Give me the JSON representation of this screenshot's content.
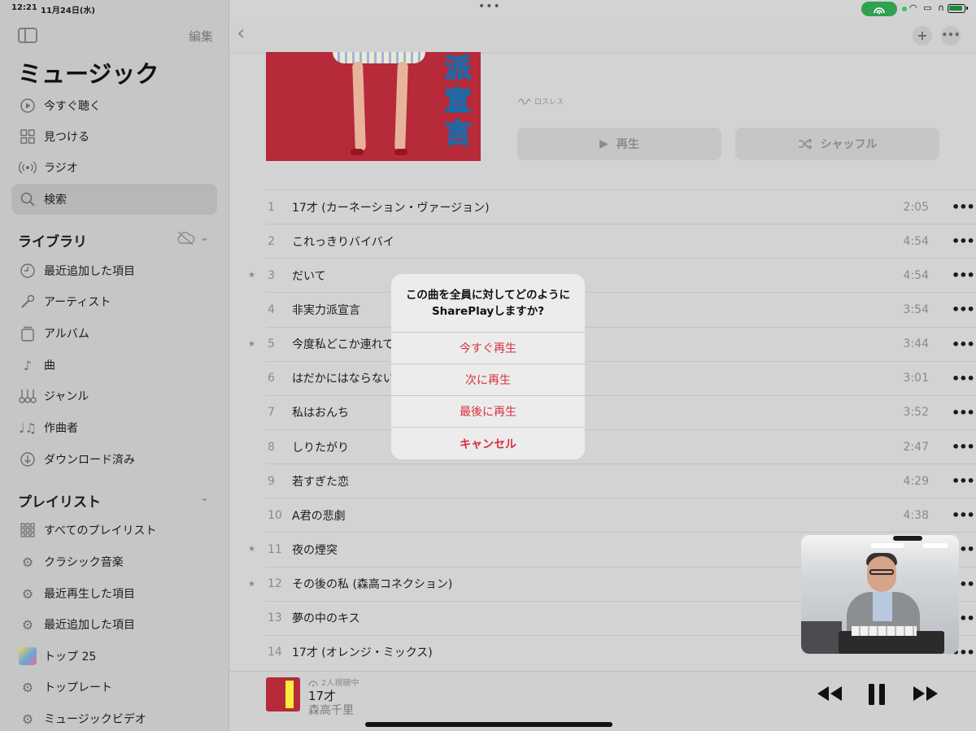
{
  "status_bar": {
    "time": "12:21",
    "date": "11月24日(水)"
  },
  "sidebar": {
    "edit_label": "編集",
    "title": "ミュージック",
    "nav": [
      {
        "label": "今すぐ聴く",
        "icon": "play-circle-icon"
      },
      {
        "label": "見つける",
        "icon": "grid-icon"
      },
      {
        "label": "ラジオ",
        "icon": "radio-icon"
      },
      {
        "label": "検索",
        "icon": "search-icon",
        "selected": true
      }
    ],
    "library_heading": "ライブラリ",
    "library": [
      {
        "label": "最近追加した項目",
        "icon": "clock-icon"
      },
      {
        "label": "アーティスト",
        "icon": "microphone-icon"
      },
      {
        "label": "アルバム",
        "icon": "album-icon"
      },
      {
        "label": "曲",
        "icon": "note-icon"
      },
      {
        "label": "ジャンル",
        "icon": "guitars-icon"
      },
      {
        "label": "作曲者",
        "icon": "notes-icon"
      },
      {
        "label": "ダウンロード済み",
        "icon": "download-icon"
      }
    ],
    "playlists_heading": "プレイリスト",
    "playlists": [
      {
        "label": "すべてのプレイリスト",
        "icon": "grid-dots-icon"
      },
      {
        "label": "クラシック音楽",
        "icon": "gear-icon"
      },
      {
        "label": "最近再生した項目",
        "icon": "gear-icon"
      },
      {
        "label": "最近追加した項目",
        "icon": "gear-icon"
      },
      {
        "label": "トップ 25",
        "icon": "playlist-thumb-icon"
      },
      {
        "label": "トップレート",
        "icon": "gear-icon"
      },
      {
        "label": "ミュージックビデオ",
        "icon": "gear-icon"
      }
    ]
  },
  "album": {
    "art_text": "派宣言",
    "lossless_label": "ロスレス",
    "play_label": "再生",
    "shuffle_label": "シャッフル"
  },
  "tracks": [
    {
      "num": "1",
      "title": "17才 (カーネーション・ヴァージョン)",
      "duration": "2:05",
      "star": false
    },
    {
      "num": "2",
      "title": "これっきりバイバイ",
      "duration": "4:54",
      "star": false
    },
    {
      "num": "3",
      "title": "だいて",
      "duration": "4:54",
      "star": true
    },
    {
      "num": "4",
      "title": "非実力派宣言",
      "duration": "3:54",
      "star": false
    },
    {
      "num": "5",
      "title": "今度私どこか連れて",
      "duration": "3:44",
      "star": true
    },
    {
      "num": "6",
      "title": "はだかにはならない",
      "duration": "3:01",
      "star": false
    },
    {
      "num": "7",
      "title": "私はおんち",
      "duration": "3:52",
      "star": false
    },
    {
      "num": "8",
      "title": "しりたがり",
      "duration": "2:47",
      "star": false
    },
    {
      "num": "9",
      "title": "若すぎた恋",
      "duration": "4:29",
      "star": false
    },
    {
      "num": "10",
      "title": "A君の悲劇",
      "duration": "4:38",
      "star": false
    },
    {
      "num": "11",
      "title": "夜の煙突",
      "duration": "",
      "star": true
    },
    {
      "num": "12",
      "title": "その後の私 (森高コネクション)",
      "duration": "",
      "star": true
    },
    {
      "num": "13",
      "title": "夢の中のキス",
      "duration": "",
      "star": false
    },
    {
      "num": "14",
      "title": "17才 (オレンジ・ミックス)",
      "duration": "",
      "star": false
    }
  ],
  "dialog": {
    "title": "この曲を全員に対してどのようにSharePlayしますか?",
    "options": [
      "今すぐ再生",
      "次に再生",
      "最後に再生",
      "キャンセル"
    ]
  },
  "player": {
    "listening": "2人視聴中",
    "title": "17才",
    "artist": "森高千里"
  },
  "colors": {
    "accent": "#d9303e",
    "dim_background": "#d3d3d3"
  }
}
